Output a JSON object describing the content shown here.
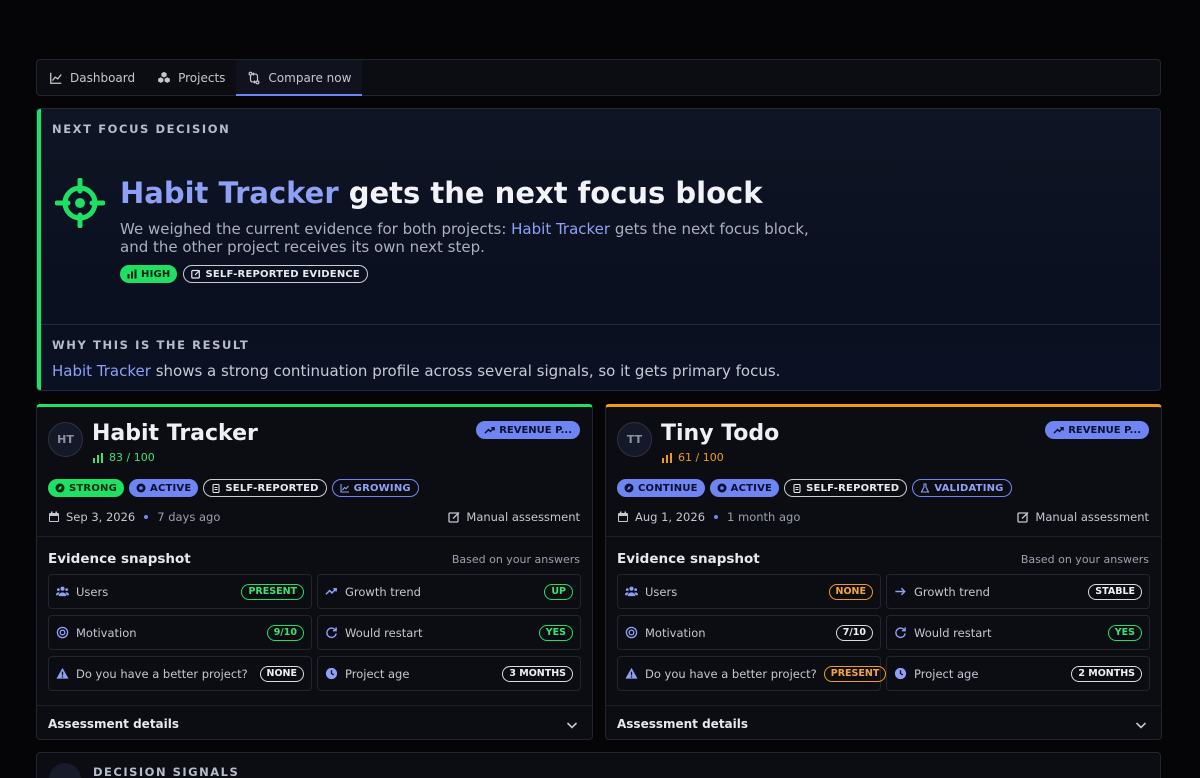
{
  "nav": {
    "tabs": [
      {
        "label": "Dashboard",
        "icon": "chart-line-icon"
      },
      {
        "label": "Projects",
        "icon": "cubes-icon"
      },
      {
        "label": "Compare now",
        "icon": "compare-arrows-icon"
      }
    ],
    "active_tab": "Compare now"
  },
  "hero": {
    "eyebrow": "NEXT FOCUS DECISION",
    "project": "Habit Tracker",
    "title_suffix": "gets the next focus block",
    "desc_prefix": "We weighed the current evidence for both projects: ",
    "desc_project": "Habit Tracker",
    "desc_suffix": " gets the next focus block, and the other project receives its own next step.",
    "confidence_badge": "HIGH",
    "evidence_badge": "SELF-REPORTED EVIDENCE",
    "why_eyebrow": "WHY THIS IS THE RESULT",
    "why_project": "Habit Tracker",
    "why_text": " shows a strong continuation profile across several signals, so it gets primary focus.",
    "accent_color": "#1fe065"
  },
  "cards": [
    {
      "initials": "HT",
      "name": "Habit Tracker",
      "score": "83 / 100",
      "revenue_badge": "REVENUE P...",
      "tags": [
        "STRONG",
        "ACTIVE",
        "SELF-REPORTED",
        "GROWING"
      ],
      "date": "Sep 3, 2026",
      "ago": "7 days ago",
      "manual": "Manual assessment",
      "snapshot_title": "Evidence snapshot",
      "snapshot_sub": "Based on your answers",
      "evidence": [
        {
          "label": "Users",
          "value": "PRESENT"
        },
        {
          "label": "Growth trend",
          "value": "UP"
        },
        {
          "label": "Motivation",
          "value": "9/10"
        },
        {
          "label": "Would restart",
          "value": "YES"
        },
        {
          "label": "Do you have a better project?",
          "value": "NONE"
        },
        {
          "label": "Project age",
          "value": "3 MONTHS"
        }
      ],
      "assessment_label": "Assessment details",
      "accent_color": "#1fe065"
    },
    {
      "initials": "TT",
      "name": "Tiny Todo",
      "score": "61 / 100",
      "revenue_badge": "REVENUE P...",
      "tags": [
        "CONTINUE",
        "ACTIVE",
        "SELF-REPORTED",
        "VALIDATING"
      ],
      "date": "Aug 1, 2026",
      "ago": "1 month ago",
      "manual": "Manual assessment",
      "snapshot_title": "Evidence snapshot",
      "snapshot_sub": "Based on your answers",
      "evidence": [
        {
          "label": "Users",
          "value": "NONE"
        },
        {
          "label": "Growth trend",
          "value": "STABLE"
        },
        {
          "label": "Motivation",
          "value": "7/10"
        },
        {
          "label": "Would restart",
          "value": "YES"
        },
        {
          "label": "Do you have a better project?",
          "value": "PRESENT"
        },
        {
          "label": "Project age",
          "value": "2 MONTHS"
        }
      ],
      "assessment_label": "Assessment details",
      "accent_color": "#f39a1c"
    }
  ],
  "signals": {
    "label": "DECISION SIGNALS"
  }
}
